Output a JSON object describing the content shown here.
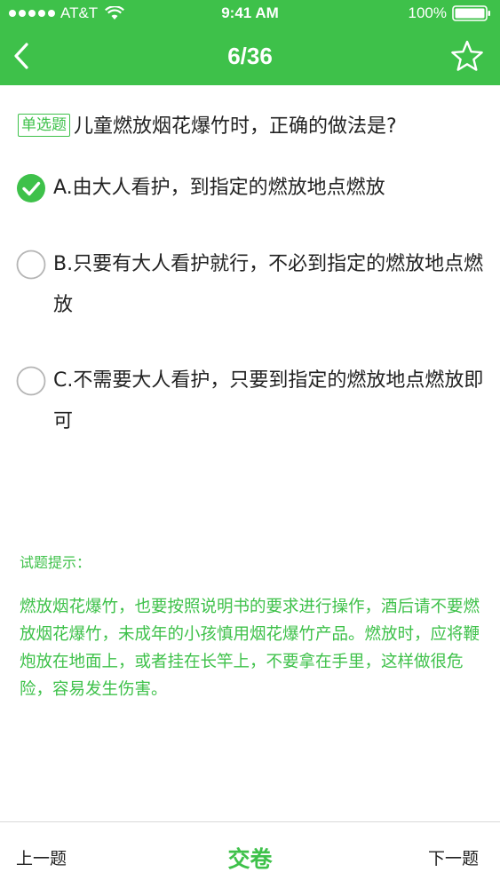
{
  "status_bar": {
    "carrier": "AT&T",
    "time": "9:41 AM",
    "battery": "100%",
    "icons": [
      "signal-dots",
      "wifi-icon",
      "battery-icon"
    ]
  },
  "nav": {
    "title": "6/36",
    "back_icon": "chevron-left-icon",
    "favorite_icon": "star-outline-icon"
  },
  "question": {
    "type_badge": "单选题",
    "text": "儿童燃放烟花爆竹时，正确的做法是?"
  },
  "options": [
    {
      "label": "A.由大人看护，到指定的燃放地点燃放",
      "selected": true,
      "icon": "check-circle-icon"
    },
    {
      "label": "B.只要有大人看护就行，不必到指定的燃放地点燃放",
      "selected": false,
      "icon": "radio-empty-icon"
    },
    {
      "label": "C.不需要大人看护，只要到指定的燃放地点燃放即可",
      "selected": false,
      "icon": "radio-empty-icon"
    }
  ],
  "hint": {
    "title": "试题提示：",
    "body": "燃放烟花爆竹，也要按照说明书的要求进行操作，酒后请不要燃放烟花爆竹，未成年的小孩慎用烟花爆竹产品。燃放时，应将鞭炮放在地面上，或者挂在长竿上，不要拿在手里，这样做很危险，容易发生伤害。"
  },
  "bottom_bar": {
    "prev": "上一题",
    "submit": "交卷",
    "next": "下一题"
  },
  "colors": {
    "accent": "#3ec14a",
    "text": "#222222",
    "radio_border": "#b5b5b5"
  }
}
